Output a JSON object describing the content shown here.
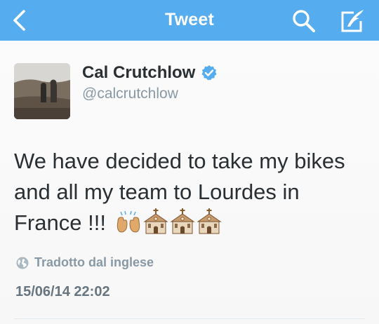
{
  "nav": {
    "title": "Tweet",
    "back_icon": "chevron-left-icon",
    "search_icon": "search-icon",
    "compose_icon": "compose-quill-icon",
    "bar_color": "#55acee"
  },
  "tweet": {
    "author_name": "Cal Crutchlow",
    "author_handle": "@calcrutchlow",
    "verified": true,
    "text": "We have decided to take my bikes and all my team to Lourdes in France !!!",
    "emojis": [
      "raised-hands-emoji",
      "church-emoji",
      "church-emoji",
      "church-emoji"
    ],
    "translation_label": "Tradotto dal inglese",
    "timestamp": "15/06/14 22:02"
  }
}
